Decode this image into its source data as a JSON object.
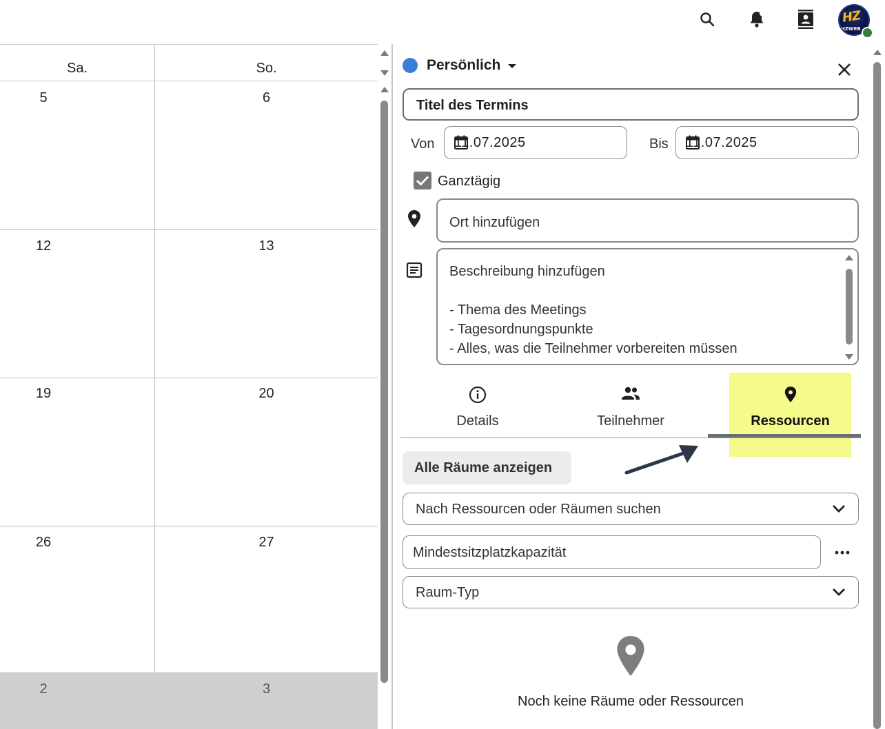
{
  "topbar": {
    "icons": [
      "search-icon",
      "notification-bell-icon",
      "contacts-icon",
      "avatar"
    ],
    "avatar_logo": "HZ",
    "avatar_sub": "HZWEB",
    "status_color": "#3a7d3a"
  },
  "calendar": {
    "headers": [
      "Sa.",
      "So."
    ],
    "rows": [
      [
        "5",
        "6"
      ],
      [
        "12",
        "13"
      ],
      [
        "19",
        "20"
      ],
      [
        "26",
        "27"
      ],
      [
        "2",
        "3"
      ]
    ]
  },
  "event": {
    "calendar_name": "Persönlich",
    "calendar_color": "#3b7dd8",
    "title": "Titel des Termins",
    "from_label": "Von",
    "from_date": "11.07.2025",
    "to_label": "Bis",
    "to_date": "11.07.2025",
    "all_day_label": "Ganztägig",
    "all_day_checked": true,
    "location_placeholder": "Ort hinzufügen",
    "description": {
      "line1": "Beschreibung hinzufügen",
      "line2": "- Thema des Meetings",
      "line3": "- Tagesordnungspunkte",
      "line4": "- Alles, was die Teilnehmer vorbereiten müssen"
    }
  },
  "tabs": [
    {
      "label": "Details",
      "icon": "info-icon",
      "active": false
    },
    {
      "label": "Teilnehmer",
      "icon": "people-icon",
      "active": false
    },
    {
      "label": "Ressourcen",
      "icon": "pin-icon",
      "active": true
    }
  ],
  "highlight_color": "#f4fb8a",
  "resources": {
    "all_rooms_button": "Alle Räume anzeigen",
    "search_placeholder": "Nach Ressourcen oder Räumen suchen",
    "capacity_placeholder": "Mindestsitzplatzkapazität",
    "room_type_placeholder": "Raum-Typ",
    "empty_text": "Noch keine Räume oder Ressourcen"
  }
}
